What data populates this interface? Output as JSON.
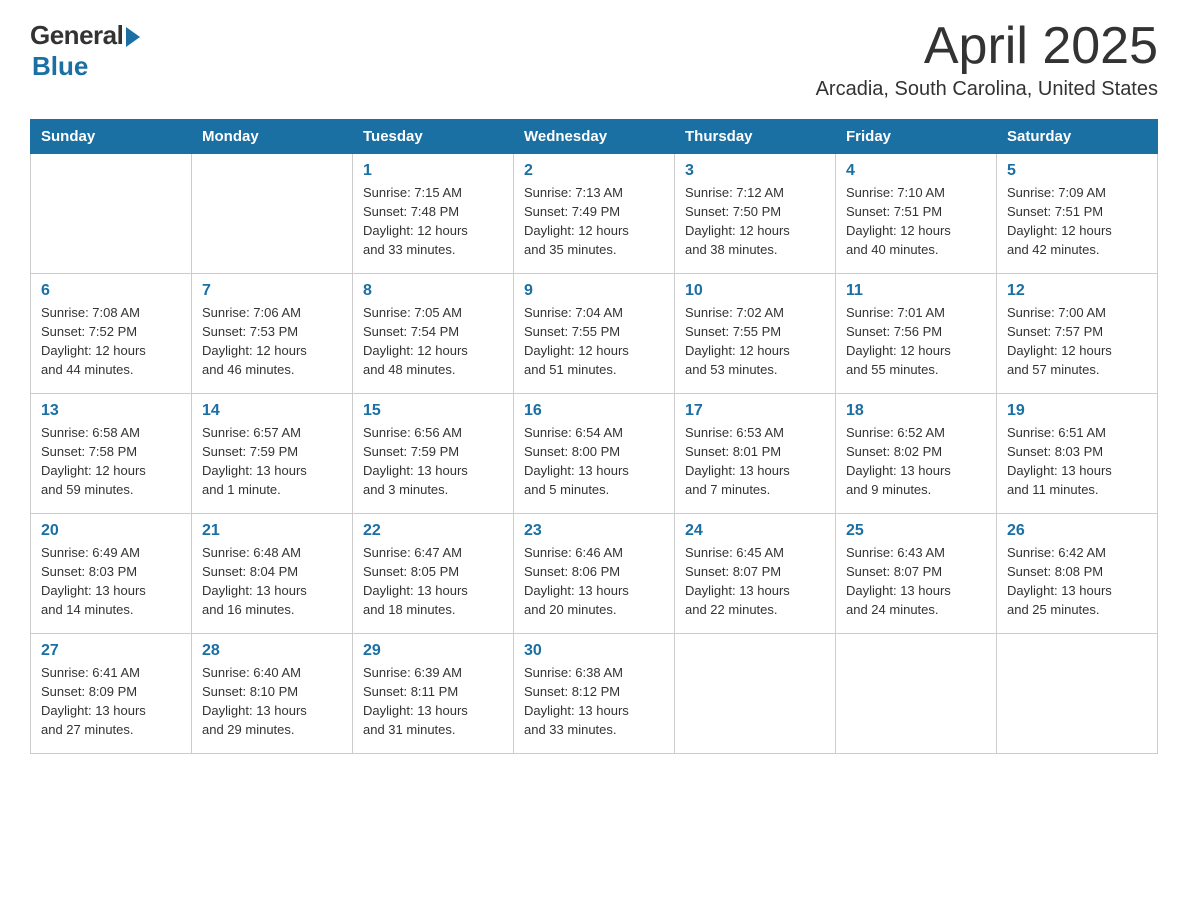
{
  "logo": {
    "text_general": "General",
    "text_blue": "Blue"
  },
  "title": {
    "month": "April 2025",
    "location": "Arcadia, South Carolina, United States"
  },
  "headers": [
    "Sunday",
    "Monday",
    "Tuesday",
    "Wednesday",
    "Thursday",
    "Friday",
    "Saturday"
  ],
  "weeks": [
    [
      {
        "day": "",
        "info": ""
      },
      {
        "day": "",
        "info": ""
      },
      {
        "day": "1",
        "info": "Sunrise: 7:15 AM\nSunset: 7:48 PM\nDaylight: 12 hours\nand 33 minutes."
      },
      {
        "day": "2",
        "info": "Sunrise: 7:13 AM\nSunset: 7:49 PM\nDaylight: 12 hours\nand 35 minutes."
      },
      {
        "day": "3",
        "info": "Sunrise: 7:12 AM\nSunset: 7:50 PM\nDaylight: 12 hours\nand 38 minutes."
      },
      {
        "day": "4",
        "info": "Sunrise: 7:10 AM\nSunset: 7:51 PM\nDaylight: 12 hours\nand 40 minutes."
      },
      {
        "day": "5",
        "info": "Sunrise: 7:09 AM\nSunset: 7:51 PM\nDaylight: 12 hours\nand 42 minutes."
      }
    ],
    [
      {
        "day": "6",
        "info": "Sunrise: 7:08 AM\nSunset: 7:52 PM\nDaylight: 12 hours\nand 44 minutes."
      },
      {
        "day": "7",
        "info": "Sunrise: 7:06 AM\nSunset: 7:53 PM\nDaylight: 12 hours\nand 46 minutes."
      },
      {
        "day": "8",
        "info": "Sunrise: 7:05 AM\nSunset: 7:54 PM\nDaylight: 12 hours\nand 48 minutes."
      },
      {
        "day": "9",
        "info": "Sunrise: 7:04 AM\nSunset: 7:55 PM\nDaylight: 12 hours\nand 51 minutes."
      },
      {
        "day": "10",
        "info": "Sunrise: 7:02 AM\nSunset: 7:55 PM\nDaylight: 12 hours\nand 53 minutes."
      },
      {
        "day": "11",
        "info": "Sunrise: 7:01 AM\nSunset: 7:56 PM\nDaylight: 12 hours\nand 55 minutes."
      },
      {
        "day": "12",
        "info": "Sunrise: 7:00 AM\nSunset: 7:57 PM\nDaylight: 12 hours\nand 57 minutes."
      }
    ],
    [
      {
        "day": "13",
        "info": "Sunrise: 6:58 AM\nSunset: 7:58 PM\nDaylight: 12 hours\nand 59 minutes."
      },
      {
        "day": "14",
        "info": "Sunrise: 6:57 AM\nSunset: 7:59 PM\nDaylight: 13 hours\nand 1 minute."
      },
      {
        "day": "15",
        "info": "Sunrise: 6:56 AM\nSunset: 7:59 PM\nDaylight: 13 hours\nand 3 minutes."
      },
      {
        "day": "16",
        "info": "Sunrise: 6:54 AM\nSunset: 8:00 PM\nDaylight: 13 hours\nand 5 minutes."
      },
      {
        "day": "17",
        "info": "Sunrise: 6:53 AM\nSunset: 8:01 PM\nDaylight: 13 hours\nand 7 minutes."
      },
      {
        "day": "18",
        "info": "Sunrise: 6:52 AM\nSunset: 8:02 PM\nDaylight: 13 hours\nand 9 minutes."
      },
      {
        "day": "19",
        "info": "Sunrise: 6:51 AM\nSunset: 8:03 PM\nDaylight: 13 hours\nand 11 minutes."
      }
    ],
    [
      {
        "day": "20",
        "info": "Sunrise: 6:49 AM\nSunset: 8:03 PM\nDaylight: 13 hours\nand 14 minutes."
      },
      {
        "day": "21",
        "info": "Sunrise: 6:48 AM\nSunset: 8:04 PM\nDaylight: 13 hours\nand 16 minutes."
      },
      {
        "day": "22",
        "info": "Sunrise: 6:47 AM\nSunset: 8:05 PM\nDaylight: 13 hours\nand 18 minutes."
      },
      {
        "day": "23",
        "info": "Sunrise: 6:46 AM\nSunset: 8:06 PM\nDaylight: 13 hours\nand 20 minutes."
      },
      {
        "day": "24",
        "info": "Sunrise: 6:45 AM\nSunset: 8:07 PM\nDaylight: 13 hours\nand 22 minutes."
      },
      {
        "day": "25",
        "info": "Sunrise: 6:43 AM\nSunset: 8:07 PM\nDaylight: 13 hours\nand 24 minutes."
      },
      {
        "day": "26",
        "info": "Sunrise: 6:42 AM\nSunset: 8:08 PM\nDaylight: 13 hours\nand 25 minutes."
      }
    ],
    [
      {
        "day": "27",
        "info": "Sunrise: 6:41 AM\nSunset: 8:09 PM\nDaylight: 13 hours\nand 27 minutes."
      },
      {
        "day": "28",
        "info": "Sunrise: 6:40 AM\nSunset: 8:10 PM\nDaylight: 13 hours\nand 29 minutes."
      },
      {
        "day": "29",
        "info": "Sunrise: 6:39 AM\nSunset: 8:11 PM\nDaylight: 13 hours\nand 31 minutes."
      },
      {
        "day": "30",
        "info": "Sunrise: 6:38 AM\nSunset: 8:12 PM\nDaylight: 13 hours\nand 33 minutes."
      },
      {
        "day": "",
        "info": ""
      },
      {
        "day": "",
        "info": ""
      },
      {
        "day": "",
        "info": ""
      }
    ]
  ]
}
